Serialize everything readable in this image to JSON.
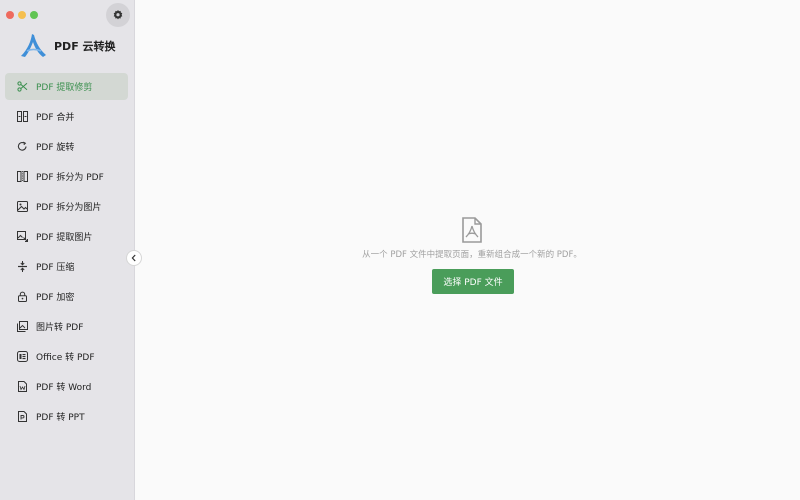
{
  "app": {
    "title": "PDF 云转换"
  },
  "sidebar": {
    "items": [
      {
        "label": "PDF 提取修剪",
        "icon": "scissors-icon",
        "active": true
      },
      {
        "label": "PDF 合并",
        "icon": "merge-icon",
        "active": false
      },
      {
        "label": "PDF 旋转",
        "icon": "rotate-icon",
        "active": false
      },
      {
        "label": "PDF 拆分为 PDF",
        "icon": "split-icon",
        "active": false
      },
      {
        "label": "PDF 拆分为图片",
        "icon": "split-image-icon",
        "active": false
      },
      {
        "label": "PDF 提取图片",
        "icon": "extract-image-icon",
        "active": false
      },
      {
        "label": "PDF 压缩",
        "icon": "compress-icon",
        "active": false
      },
      {
        "label": "PDF 加密",
        "icon": "lock-icon",
        "active": false
      },
      {
        "label": "图片转 PDF",
        "icon": "images-icon",
        "active": false
      },
      {
        "label": "Office 转 PDF",
        "icon": "office-icon",
        "active": false
      },
      {
        "label": "PDF 转 Word",
        "icon": "word-file-icon",
        "active": false
      },
      {
        "label": "PDF 转 PPT",
        "icon": "ppt-file-icon",
        "active": false
      }
    ]
  },
  "main": {
    "empty_text": "从一个 PDF 文件中提取页面，重新组合成一个新的 PDF。",
    "select_button": "选择 PDF 文件"
  },
  "colors": {
    "accent": "#4a9d5a",
    "active_text": "#3a8f4e",
    "sidebar_bg": "#e5e4e8",
    "logo": "#3f8fd8"
  }
}
